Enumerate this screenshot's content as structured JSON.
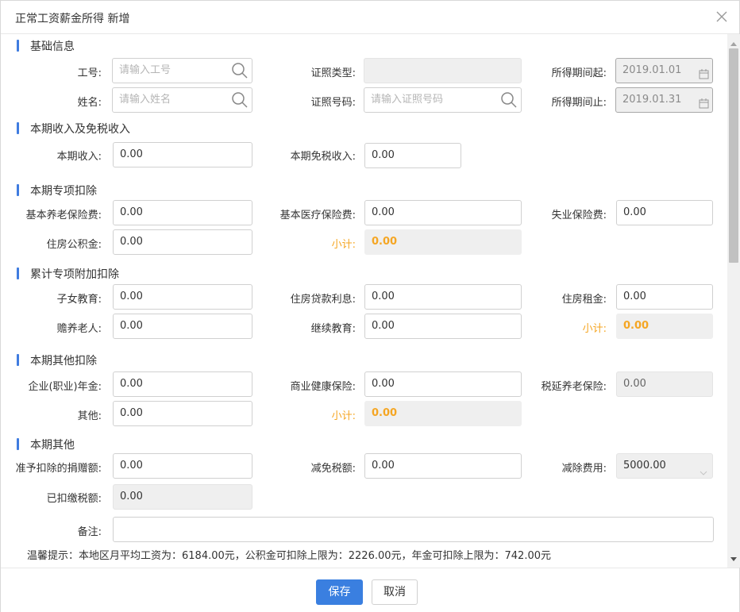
{
  "dialog": {
    "title": "正常工资薪金所得 新增",
    "close_icon": "close-icon"
  },
  "sections": {
    "basic": "基础信息",
    "income": "本期收入及免税收入",
    "special": "本期专项扣除",
    "cumulative": "累计专项附加扣除",
    "other_deduct": "本期其他扣除",
    "other": "本期其他"
  },
  "basic": {
    "job_no_label": "工号:",
    "job_no_placeholder": "请输入工号",
    "name_label": "姓名:",
    "name_placeholder": "请输入姓名",
    "id_type_label": "证照类型:",
    "id_type_value": "",
    "id_no_label": "证照号码:",
    "id_no_placeholder": "请输入证照号码",
    "period_start_label": "所得期间起:",
    "period_start_value": "2019.01.01",
    "period_end_label": "所得期间止:",
    "period_end_value": "2019.01.31"
  },
  "income": {
    "income_label": "本期收入:",
    "income_value": "0.00",
    "taxfree_label": "本期免税收入:",
    "taxfree_value": "0.00"
  },
  "special": {
    "pension_label": "基本养老保险费:",
    "pension_value": "0.00",
    "medical_label": "基本医疗保险费:",
    "medical_value": "0.00",
    "unemployment_label": "失业保险费:",
    "unemployment_value": "0.00",
    "housing_fund_label": "住房公积金:",
    "housing_fund_value": "0.00",
    "subtotal_label": "小计:",
    "subtotal_value": "0.00"
  },
  "cumulative": {
    "child_edu_label": "子女教育:",
    "child_edu_value": "0.00",
    "loan_interest_label": "住房贷款利息:",
    "loan_interest_value": "0.00",
    "rent_label": "住房租金:",
    "rent_value": "0.00",
    "elderly_label": "赡养老人:",
    "elderly_value": "0.00",
    "continuing_edu_label": "继续教育:",
    "continuing_edu_value": "0.00",
    "subtotal_label": "小计:",
    "subtotal_value": "0.00"
  },
  "other_deduct": {
    "annuity_label": "企业(职业)年金:",
    "annuity_value": "0.00",
    "health_ins_label": "商业健康保险:",
    "health_ins_value": "0.00",
    "deferred_pension_label": "税延养老保险:",
    "deferred_pension_value": "0.00",
    "others_label": "其他:",
    "others_value": "0.00",
    "subtotal_label": "小计:",
    "subtotal_value": "0.00"
  },
  "other": {
    "donation_label": "准予扣除的捐赠额:",
    "donation_value": "0.00",
    "tax_relief_label": "减免税额:",
    "tax_relief_value": "0.00",
    "deduct_fee_label": "减除费用:",
    "deduct_fee_value": "5000.00",
    "paid_tax_label": "已扣缴税额:",
    "paid_tax_value": "0.00",
    "remark_label": "备注:",
    "remark_value": ""
  },
  "tip": "温馨提示：本地区月平均工资为：6184.00元，公积金可扣除上限为：2226.00元，年金可扣除上限为：742.00元",
  "footer": {
    "save_label": "保存",
    "cancel_label": "取消"
  },
  "colors": {
    "accent": "#3a7fe0",
    "subtotal": "#f5a623",
    "disabled_bg": "#efefef"
  }
}
